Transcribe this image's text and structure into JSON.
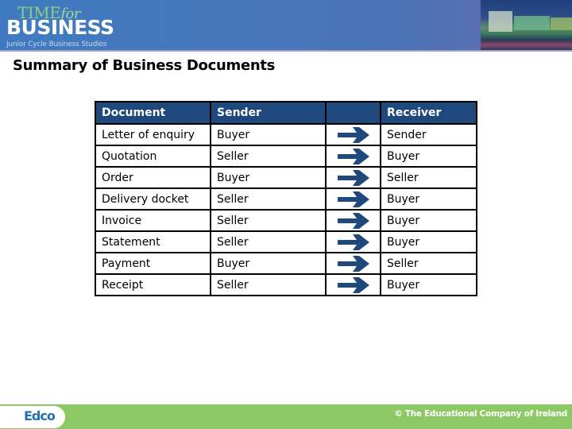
{
  "header": {
    "logo_time": "TIME",
    "logo_for": "for",
    "logo_business": "BUSINESS",
    "logo_subtitle": "Junior Cycle Business Studies"
  },
  "slide": {
    "title": "Summary of Business Documents"
  },
  "table": {
    "headers": [
      "Document",
      "Sender",
      "",
      "Receiver"
    ],
    "arrow_icon": "right-arrow-icon",
    "rows": [
      {
        "document": "Letter of enquiry",
        "sender": "Buyer",
        "receiver": "Sender"
      },
      {
        "document": "Quotation",
        "sender": "Seller",
        "receiver": "Buyer"
      },
      {
        "document": "Order",
        "sender": "Buyer",
        "receiver": "Seller"
      },
      {
        "document": "Delivery docket",
        "sender": "Seller",
        "receiver": "Buyer"
      },
      {
        "document": "Invoice",
        "sender": "Seller",
        "receiver": "Buyer"
      },
      {
        "document": "Statement",
        "sender": "Seller",
        "receiver": "Buyer"
      },
      {
        "document": "Payment",
        "sender": "Buyer",
        "receiver": "Seller"
      },
      {
        "document": "Receipt",
        "sender": "Seller",
        "receiver": "Buyer"
      }
    ]
  },
  "footer": {
    "publisher_logo": "Edco",
    "copyright": "© The Educational Company of Ireland"
  },
  "colors": {
    "header_blue": "#4878bc",
    "table_header": "#1f497d",
    "arrow": "#1f497d",
    "footer_green": "#8cc864",
    "edco_blue": "#1f6fb2"
  }
}
